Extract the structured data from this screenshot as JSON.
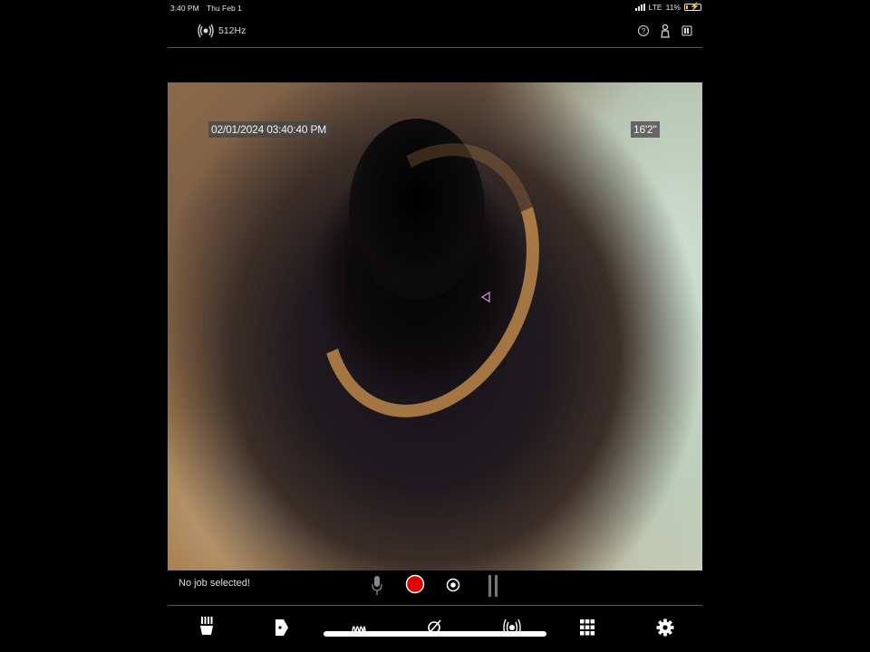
{
  "status_bar": {
    "time": "3:40 PM",
    "date": "Thu Feb 1",
    "carrier": "LTE",
    "battery_percent": "11%",
    "battery_level": 0.11,
    "charging": true
  },
  "top_bar": {
    "frequency": "512Hz",
    "icons": [
      "sonde-icon",
      "help-icon",
      "user-icon",
      "battery-icon"
    ]
  },
  "camera": {
    "timestamp": "02/01/2024  03:40:40 PM",
    "distance": "16'2\""
  },
  "status_row": {
    "job_status": "No job selected!",
    "controls": [
      "microphone-icon",
      "record-button",
      "snapshot-button",
      "pause-button"
    ]
  },
  "bottom_nav": {
    "items": [
      "camera-head-icon",
      "tag-icon",
      "locator-icon",
      "diameter-icon",
      "sonde-icon",
      "grid-icon",
      "settings-icon"
    ]
  },
  "colors": {
    "record": "#e00000",
    "accent": "#ffffff",
    "background": "#000000"
  }
}
